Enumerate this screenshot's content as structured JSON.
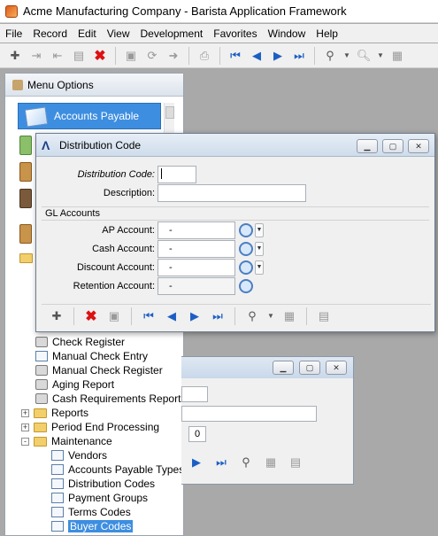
{
  "window": {
    "title": "Acme Manufacturing Company - Barista Application Framework"
  },
  "menubar": [
    "File",
    "Record",
    "Edit",
    "View",
    "Development",
    "Favorites",
    "Window",
    "Help"
  ],
  "menu_panel": {
    "title": "Menu Options",
    "selected_module": "Accounts Payable",
    "tree": [
      {
        "label": "Check Register",
        "icon": "printer-icon"
      },
      {
        "label": "Manual Check Entry",
        "icon": "form-icon"
      },
      {
        "label": "Manual Check Register",
        "icon": "printer-icon"
      },
      {
        "label": "Aging Report",
        "icon": "printer-icon"
      },
      {
        "label": "Cash Requirements Report",
        "icon": "printer-icon"
      },
      {
        "label": "Reports",
        "icon": "folder-icon",
        "expander": "+"
      },
      {
        "label": "Period End Processing",
        "icon": "folder-icon",
        "expander": "+"
      },
      {
        "label": "Maintenance",
        "icon": "folder-open-icon",
        "expander": "-"
      },
      {
        "label": "Vendors",
        "icon": "form-icon"
      },
      {
        "label": "Accounts Payable Types",
        "icon": "form-icon"
      },
      {
        "label": "Distribution Codes",
        "icon": "form-icon"
      },
      {
        "label": "Payment Groups",
        "icon": "form-icon"
      },
      {
        "label": "Terms Codes",
        "icon": "form-icon"
      },
      {
        "label": "Buyer Codes",
        "icon": "form-icon",
        "selected": true
      }
    ]
  },
  "background_window": {
    "field_value": "0"
  },
  "dialog": {
    "title": "Distribution Code",
    "fields": {
      "distribution_code_label": "Distribution Code:",
      "distribution_code_value": "",
      "description_label": "Description:",
      "description_value": ""
    },
    "gl_section": "GL Accounts",
    "gl_accounts": [
      {
        "label": "AP Account:",
        "value": "-"
      },
      {
        "label": "Cash Account:",
        "value": "-"
      },
      {
        "label": "Discount Account:",
        "value": "-"
      },
      {
        "label": "Retention Account:",
        "value": "-"
      }
    ]
  },
  "colors": {
    "selection": "#3d8ee0",
    "delete": "#dd1111",
    "nav": "#1c5fc4"
  }
}
